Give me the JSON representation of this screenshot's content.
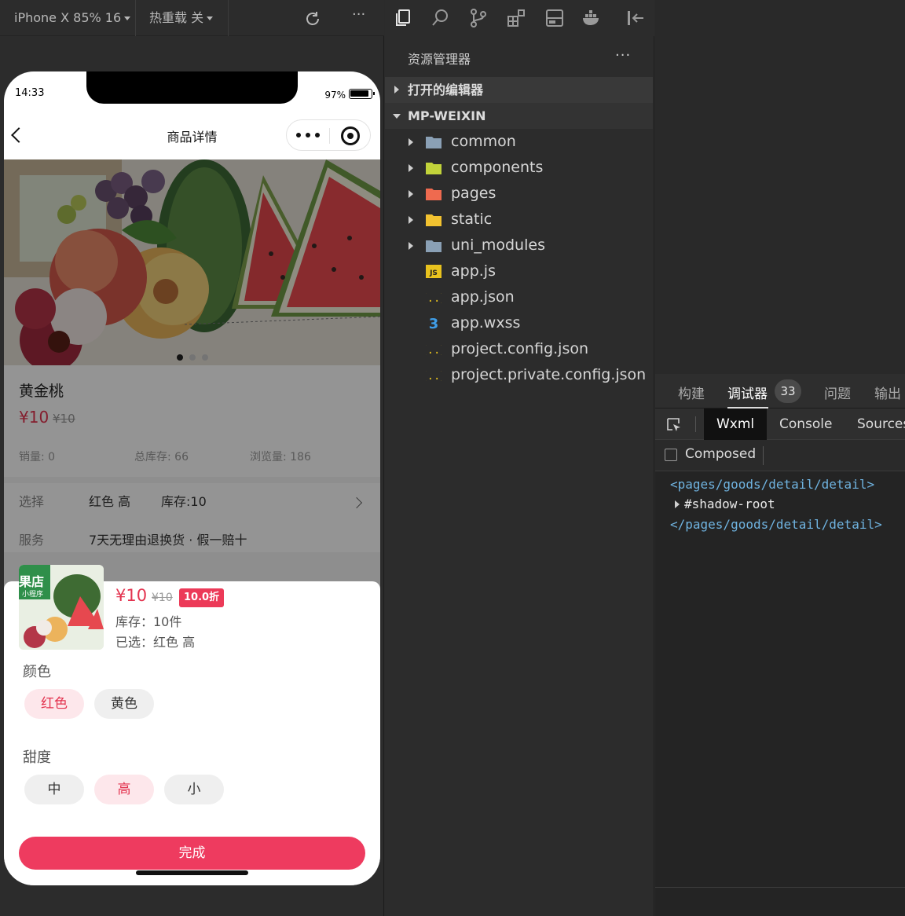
{
  "simulator": {
    "device_label": "iPhone X 85% 16",
    "hot_reload_label": "热重载 关",
    "more_label": "···"
  },
  "phone": {
    "status_time": "14:33",
    "battery": "97%",
    "nav_title": "商品详情"
  },
  "goods": {
    "title": "黄金桃",
    "price": "¥10",
    "old_price": "¥10",
    "stats": [
      "销量: 0",
      "总库存: 66",
      "浏览量: 186"
    ],
    "choose_label": "选择",
    "choose_value": "红色 高",
    "choose_stock": "库存:10",
    "service_label": "服务",
    "service_value": "7天无理由退换货 · 假一赔十"
  },
  "sku": {
    "price": "¥10",
    "old_price": "¥10",
    "discount": "10.0折",
    "stock": "库存：10件",
    "selected": "已选：红色 高",
    "thumb_text_1": "果店",
    "thumb_text_2": "小程序",
    "groups": [
      {
        "name": "颜色",
        "options": [
          {
            "label": "红色",
            "selected": true
          },
          {
            "label": "黄色",
            "selected": false
          }
        ]
      },
      {
        "name": "甜度",
        "options": [
          {
            "label": "中",
            "selected": false
          },
          {
            "label": "高",
            "selected": true
          },
          {
            "label": "小",
            "selected": false
          }
        ]
      }
    ],
    "done_label": "完成"
  },
  "explorer": {
    "title": "资源管理器",
    "more": "···",
    "open_editors": "打开的编辑器",
    "project": "MP-WEIXIN",
    "tree": [
      {
        "name": "common",
        "kind": "folder",
        "icon": "folder-icon",
        "color": "#8aa0b5"
      },
      {
        "name": "components",
        "kind": "folder",
        "icon": "components-folder-icon",
        "color": "#c2d33a"
      },
      {
        "name": "pages",
        "kind": "folder",
        "icon": "pages-folder-icon",
        "color": "#ef6a4f"
      },
      {
        "name": "static",
        "kind": "folder",
        "icon": "static-folder-icon",
        "color": "#f2c230"
      },
      {
        "name": "uni_modules",
        "kind": "folder",
        "icon": "folder-icon",
        "color": "#8aa0b5"
      },
      {
        "name": "app.js",
        "kind": "file",
        "icon": "js-file-icon",
        "color": "#e8c21e",
        "glyph": "JS"
      },
      {
        "name": "app.json",
        "kind": "file",
        "icon": "json-file-icon",
        "color": "#e8c21e",
        "glyph": "{..}"
      },
      {
        "name": "app.wxss",
        "kind": "file",
        "icon": "css-file-icon",
        "color": "#3f9ee8",
        "glyph": "3"
      },
      {
        "name": "project.config.json",
        "kind": "file",
        "icon": "json-file-icon",
        "color": "#e8c21e",
        "glyph": "{..}"
      },
      {
        "name": "project.private.config.json",
        "kind": "file",
        "icon": "json-file-icon",
        "color": "#e8c21e",
        "glyph": "{..}"
      }
    ]
  },
  "devtools": {
    "tabs": [
      "构建",
      "调试器",
      "问题",
      "输出"
    ],
    "badge": "33",
    "subtabs": [
      "Wxml",
      "Console",
      "Sources"
    ],
    "composed_label": "Composed",
    "dom": {
      "open_tag": "<pages/goods/detail/detail>",
      "shadow_root": "#shadow-root",
      "close_tag": "</pages/goods/detail/detail>"
    }
  },
  "colors": {
    "accent": "#ee3b5f",
    "price": "#e3334f",
    "tag": "#6fb3e0"
  }
}
